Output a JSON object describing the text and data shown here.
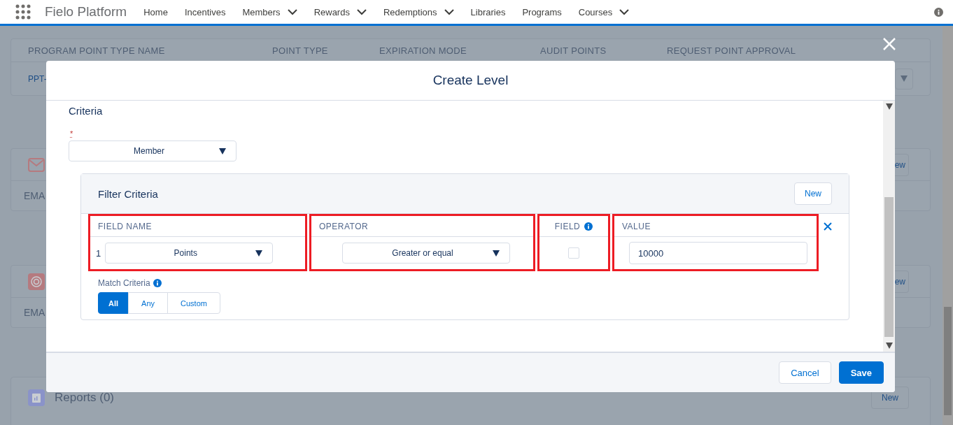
{
  "nav": {
    "app_name": "Fielo Platform",
    "items": [
      {
        "label": "Home",
        "has_menu": false
      },
      {
        "label": "Incentives",
        "has_menu": false
      },
      {
        "label": "Members",
        "has_menu": true
      },
      {
        "label": "Rewards",
        "has_menu": true
      },
      {
        "label": "Redemptions",
        "has_menu": true
      },
      {
        "label": "Libraries",
        "has_menu": false
      },
      {
        "label": "Programs",
        "has_menu": false
      },
      {
        "label": "Courses",
        "has_menu": true
      }
    ]
  },
  "background": {
    "table_headers": [
      "PROGRAM POINT TYPE NAME",
      "POINT TYPE",
      "EXPIRATION MODE",
      "AUDIT POINTS",
      "REQUEST POINT APPROVAL"
    ],
    "row_cell": "PPT-",
    "sections": [
      {
        "kind": "mail",
        "label": "EMA",
        "button": "ew"
      },
      {
        "kind": "target",
        "label": "EMA",
        "button": "ew"
      }
    ],
    "reports": {
      "title": "Reports (0)",
      "button": "New"
    }
  },
  "modal": {
    "title": "Create Level",
    "criteria_heading": "Criteria",
    "required_mark": "*",
    "object_select": "Member",
    "filter": {
      "title": "Filter Criteria",
      "new_button": "New",
      "columns": [
        {
          "label": "FIELD NAME",
          "info": false,
          "highlighted": true
        },
        {
          "label": "OPERATOR",
          "info": false,
          "highlighted": true
        },
        {
          "label": "FIELD",
          "info": true,
          "highlighted": true
        },
        {
          "label": "VALUE",
          "info": false,
          "highlighted": true
        }
      ],
      "rows": [
        {
          "index": "1",
          "field": "Points",
          "operator": "Greater or equal",
          "field_checked": false,
          "value": "10000"
        }
      ],
      "match_label": "Match Criteria",
      "match_options": [
        {
          "label": "All",
          "selected": true
        },
        {
          "label": "Any",
          "selected": false
        },
        {
          "label": "Custom",
          "selected": false
        }
      ]
    },
    "buttons": [
      {
        "label": "Cancel",
        "kind": "neutral"
      },
      {
        "label": "Save",
        "kind": "brand"
      }
    ]
  }
}
